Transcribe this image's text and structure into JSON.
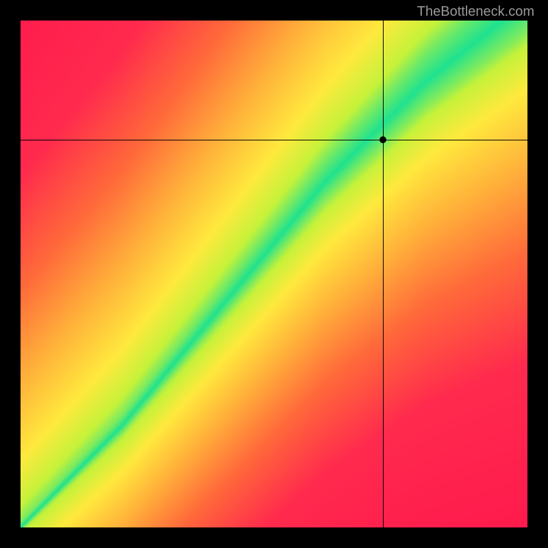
{
  "watermark": "TheBottleneck.com",
  "chart_data": {
    "type": "heatmap",
    "title": "",
    "xlabel": "",
    "ylabel": "",
    "xlim": [
      0,
      1
    ],
    "ylim": [
      0,
      1
    ],
    "crosshair": {
      "x": 0.715,
      "y": 0.765
    },
    "marker": {
      "x": 0.715,
      "y": 0.765
    },
    "optimal_band": {
      "description": "green diagonal band where GPU/CPU balance is ideal; red = bottleneck, yellow = transition",
      "curve_points": [
        {
          "x": 0.0,
          "center_y": 0.0,
          "half_width": 0.01
        },
        {
          "x": 0.1,
          "center_y": 0.1,
          "half_width": 0.015
        },
        {
          "x": 0.2,
          "center_y": 0.2,
          "half_width": 0.02
        },
        {
          "x": 0.3,
          "center_y": 0.32,
          "half_width": 0.025
        },
        {
          "x": 0.4,
          "center_y": 0.44,
          "half_width": 0.03
        },
        {
          "x": 0.5,
          "center_y": 0.56,
          "half_width": 0.035
        },
        {
          "x": 0.6,
          "center_y": 0.68,
          "half_width": 0.04
        },
        {
          "x": 0.7,
          "center_y": 0.78,
          "half_width": 0.045
        },
        {
          "x": 0.8,
          "center_y": 0.88,
          "half_width": 0.05
        },
        {
          "x": 0.9,
          "center_y": 0.96,
          "half_width": 0.055
        },
        {
          "x": 1.0,
          "center_y": 1.04,
          "half_width": 0.06
        }
      ]
    },
    "color_scale": [
      {
        "distance": 0.0,
        "color": "#1fe28f"
      },
      {
        "distance": 0.08,
        "color": "#c6f23a"
      },
      {
        "distance": 0.18,
        "color": "#ffe93d"
      },
      {
        "distance": 0.35,
        "color": "#ffb13a"
      },
      {
        "distance": 0.55,
        "color": "#ff6a3a"
      },
      {
        "distance": 0.8,
        "color": "#ff2a4d"
      },
      {
        "distance": 1.2,
        "color": "#ff1a4d"
      }
    ]
  }
}
